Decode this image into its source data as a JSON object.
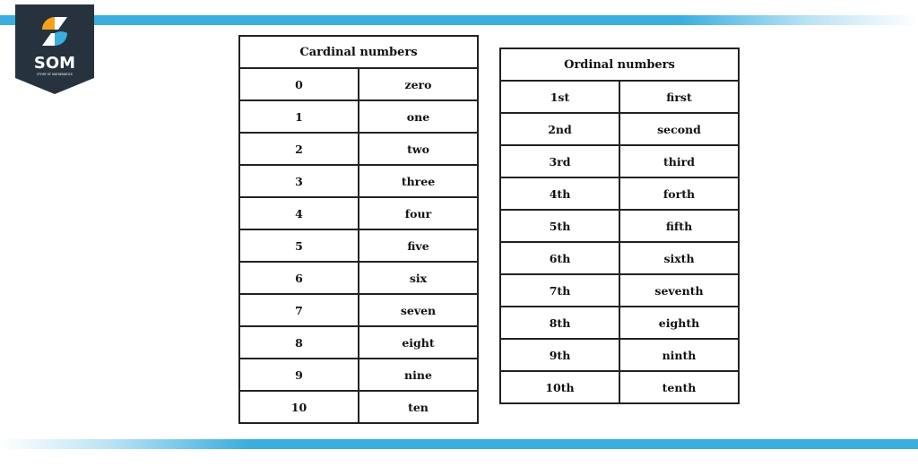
{
  "logo": {
    "text": "SOM",
    "tagline": "STORY OF MATHEMATICS",
    "colors": {
      "bg": "#26333f",
      "orange": "#f7a11a",
      "blue": "#3aaedf"
    }
  },
  "decor": {
    "accent": "#3aaedf"
  },
  "cardinal": {
    "title": "Cardinal numbers",
    "rows": [
      [
        "0",
        "zero"
      ],
      [
        "1",
        "one"
      ],
      [
        "2",
        "two"
      ],
      [
        "3",
        "three"
      ],
      [
        "4",
        "four"
      ],
      [
        "5",
        "five"
      ],
      [
        "6",
        "six"
      ],
      [
        "7",
        "seven"
      ],
      [
        "8",
        "eight"
      ],
      [
        "9",
        "nine"
      ],
      [
        "10",
        "ten"
      ]
    ]
  },
  "ordinal": {
    "title": "Ordinal numbers",
    "rows": [
      [
        "1st",
        "first"
      ],
      [
        "2nd",
        "second"
      ],
      [
        "3rd",
        "third"
      ],
      [
        "4th",
        "forth"
      ],
      [
        "5th",
        "fifth"
      ],
      [
        "6th",
        "sixth"
      ],
      [
        "7th",
        "seventh"
      ],
      [
        "8th",
        "eighth"
      ],
      [
        "9th",
        "ninth"
      ],
      [
        "10th",
        "tenth"
      ]
    ]
  }
}
